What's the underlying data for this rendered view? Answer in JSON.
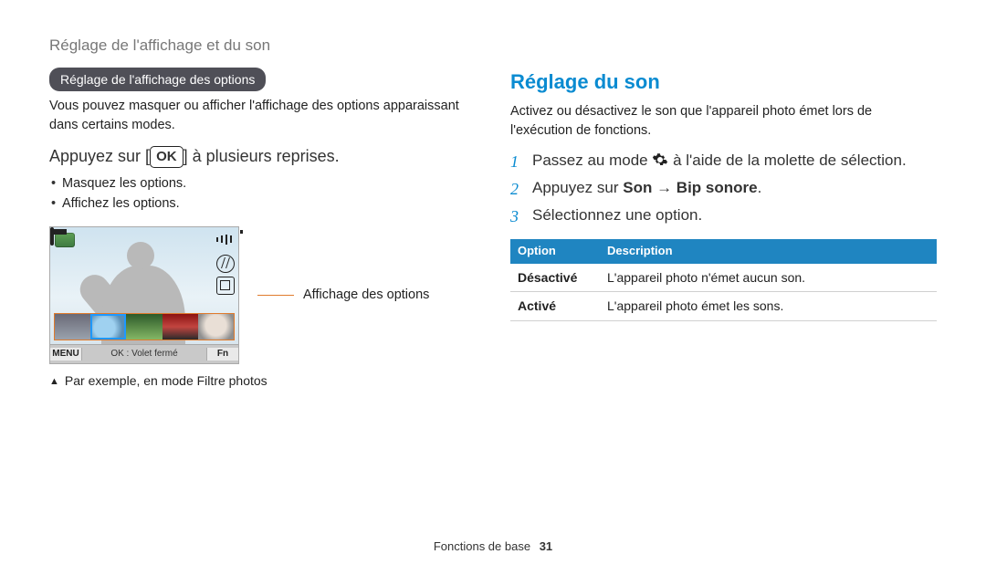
{
  "header": {
    "title": "Réglage de l'affichage et du son"
  },
  "left": {
    "pill": "Réglage de l'affichage des options",
    "intro": "Vous pouvez masquer ou afficher l'affichage des options apparaissant dans certains modes.",
    "press_pre": "Appuyez sur [",
    "ok_label": "OK",
    "press_post": "] à plusieurs reprises.",
    "bullets": [
      "Masquez les options.",
      "Affichez les options."
    ],
    "shot_bar": {
      "menu": "MENU",
      "center": "OK : Volet fermé",
      "fn": "Fn"
    },
    "pointer_label": "Affichage des options",
    "caption": "Par exemple, en mode Filtre photos"
  },
  "right": {
    "title": "Réglage du son",
    "intro": "Activez ou désactivez le son que l'appareil photo émet lors de l'exécution de fonctions.",
    "steps": {
      "s1_pre": "Passez au mode ",
      "s1_post": " à l'aide de la molette de sélection.",
      "s2_pre": "Appuyez sur ",
      "s2_b1": "Son",
      "s2_arrow": " → ",
      "s2_b2": "Bip sonore",
      "s2_post": ".",
      "s3": "Sélectionnez une option."
    },
    "table": {
      "h_option": "Option",
      "h_desc": "Description",
      "rows": [
        {
          "k": "Désactivé",
          "v": "L'appareil photo n'émet aucun son."
        },
        {
          "k": "Activé",
          "v": "L'appareil photo émet les sons."
        }
      ]
    }
  },
  "footer": {
    "section": "Fonctions de base",
    "page": "31"
  }
}
